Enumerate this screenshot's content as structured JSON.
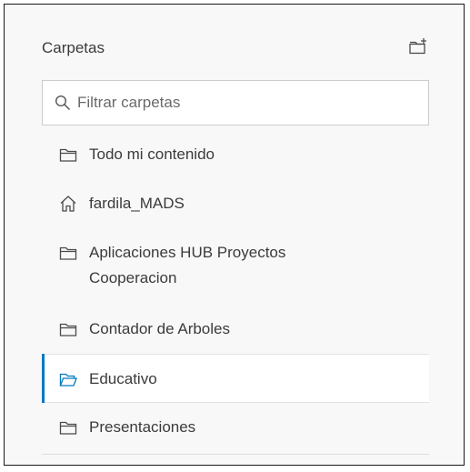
{
  "header": {
    "title": "Carpetas",
    "new_folder_icon": "folder-plus-icon"
  },
  "search": {
    "placeholder": "Filtrar carpetas",
    "value": "",
    "icon": "search-icon"
  },
  "folders": [
    {
      "label": "Todo mi contenido",
      "icon": "folder-icon"
    },
    {
      "label": "fardila_MADS",
      "icon": "home-icon"
    },
    {
      "label": "Aplicaciones HUB Proyectos Cooperacion",
      "icon": "folder-icon"
    },
    {
      "label": "Contador de Arboles",
      "icon": "folder-icon"
    },
    {
      "label": "Educativo",
      "icon": "folder-open-icon",
      "selected": true
    },
    {
      "label": "Presentaciones",
      "icon": "folder-icon"
    }
  ],
  "colors": {
    "accent": "#0079c1",
    "text": "#3b3b3b",
    "panel_bg": "#f8f8f8"
  }
}
